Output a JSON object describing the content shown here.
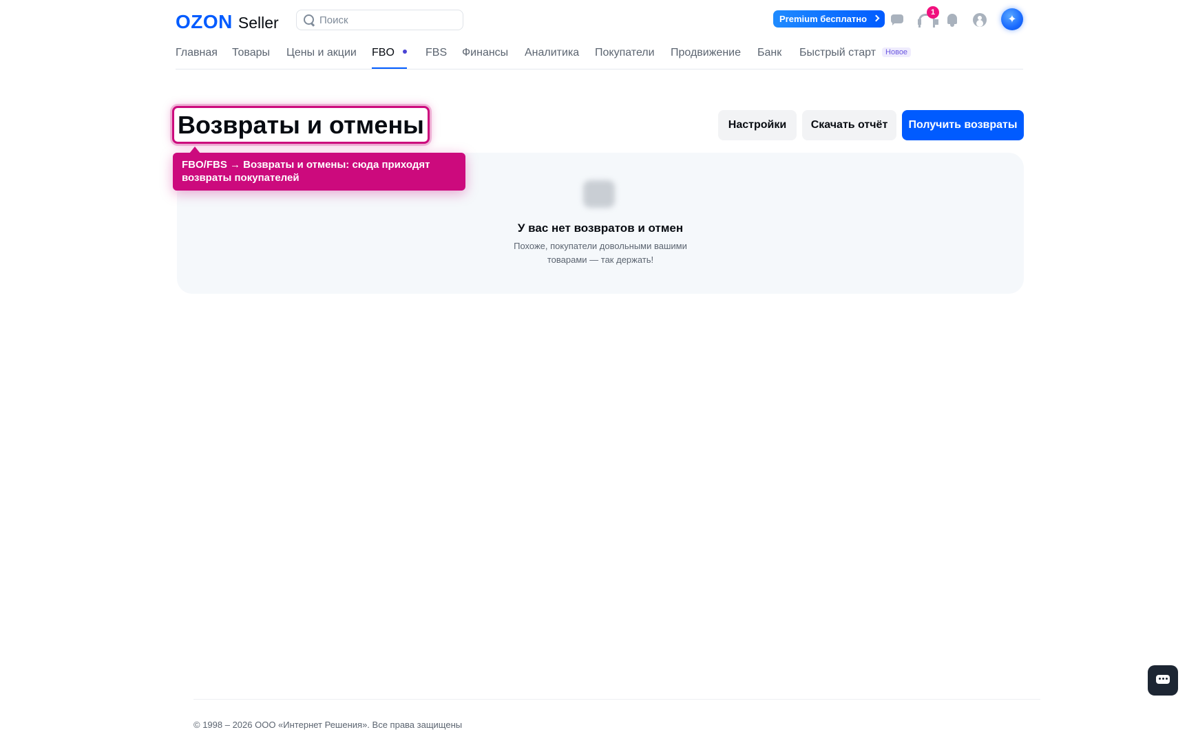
{
  "header": {
    "logo_brand": "OZON",
    "logo_product": "Seller",
    "search": {
      "placeholder": "Поиск",
      "value": ""
    },
    "premium_label": "Premium бесплатно",
    "support_badge": "1",
    "icons": [
      "search-icon",
      "chat-icon",
      "support-icon",
      "bell-icon",
      "profile-icon",
      "ai-assistant-icon"
    ]
  },
  "nav": {
    "items": [
      {
        "label": "Главная"
      },
      {
        "label": "Товары"
      },
      {
        "label": "Цены и акции"
      },
      {
        "label": "FBO",
        "active": true
      },
      {
        "label": "FBS"
      },
      {
        "label": "Финансы"
      },
      {
        "label": "Аналитика"
      },
      {
        "label": "Покупатели"
      },
      {
        "label": "Продвижение"
      },
      {
        "label": "Банк"
      },
      {
        "label": "Быстрый старт",
        "badge": "Новое"
      }
    ]
  },
  "page": {
    "title": "Возвраты и отмены",
    "buttons": {
      "settings": "Настройки",
      "download": "Скачать отчёт",
      "get_returns": "Получить возвраты"
    }
  },
  "tooltip": {
    "text": "FBO/FBS → Возвраты и отмены: сюда приходят возвраты покупателей"
  },
  "empty_state": {
    "title": "У вас нет возвратов и отмен",
    "text": "Похоже, покупатели довольными вашими товарами — так держать!"
  },
  "footer": {
    "copyright": "© 1998 – 2026 ООО «Интернет Решения». Все права защищены"
  },
  "colors": {
    "brand": "#005bff",
    "highlight": "#cc0a7d",
    "badge": "#f1117e",
    "nav_dot": "#4a44d4"
  }
}
